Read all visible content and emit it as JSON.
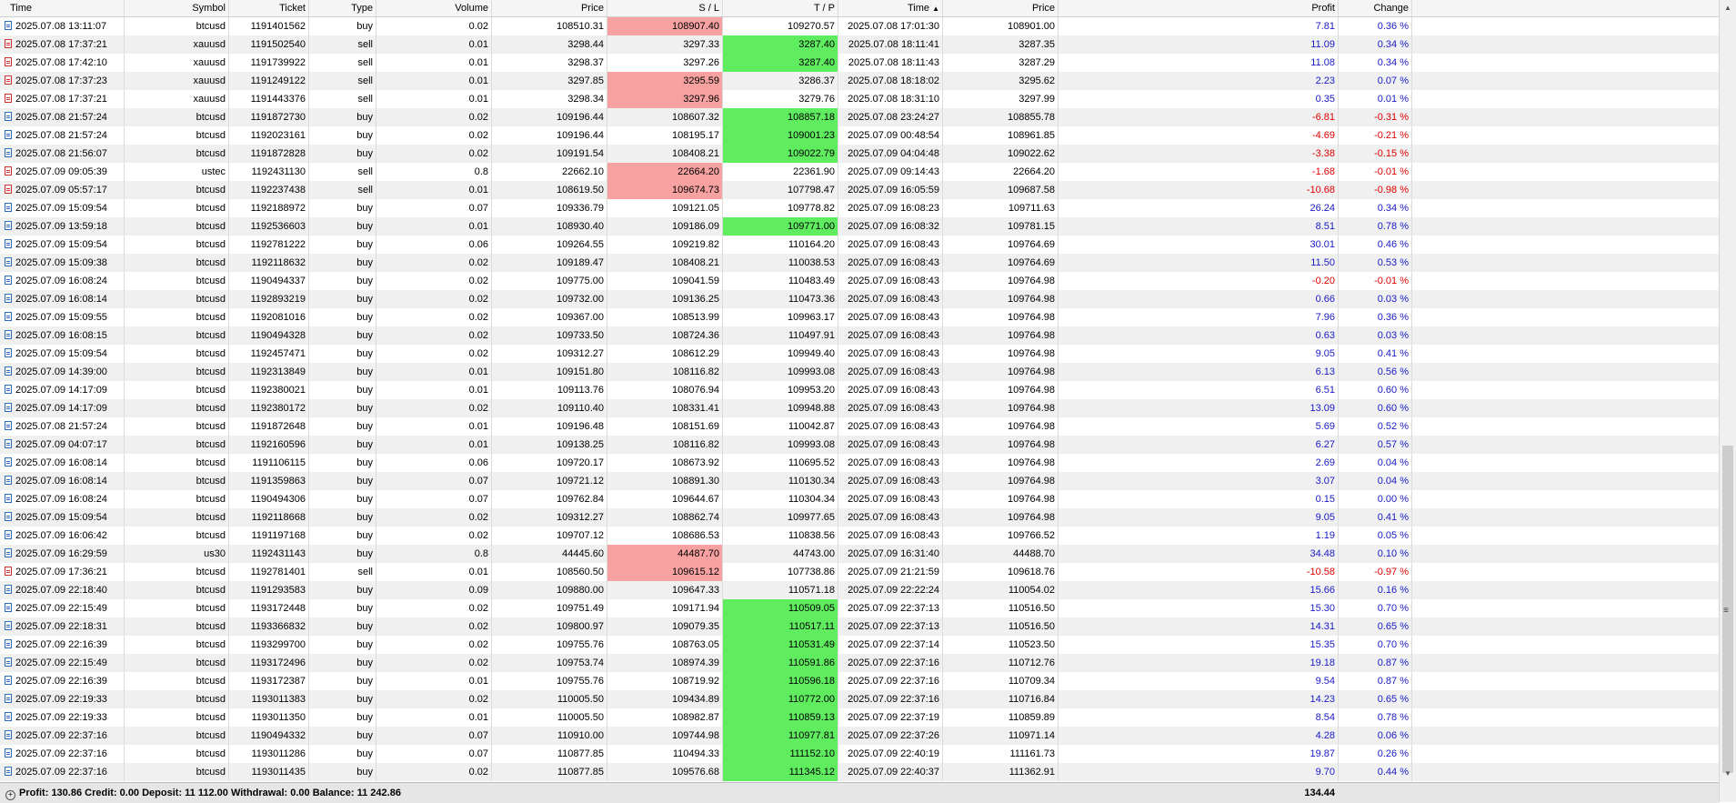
{
  "headers": {
    "time": "Time",
    "symbol": "Symbol",
    "ticket": "Ticket",
    "type": "Type",
    "volume": "Volume",
    "price": "Price",
    "sl": "S / L",
    "tp": "T / P",
    "close_time": "Time",
    "close_price": "Price",
    "profit": "Profit",
    "change": "Change",
    "sort_indicator": "▲"
  },
  "rows": [
    {
      "time": "2025.07.08 13:11:07",
      "symbol": "btcusd",
      "ticket": "1191401562",
      "type": "buy",
      "volume": "0.02",
      "price": "108510.31",
      "sl": "108907.40",
      "tp": "109270.57",
      "close_time": "2025.07.08 17:01:30",
      "close_price": "108901.00",
      "profit": "7.81",
      "change": "0.36 %",
      "hit": "sl"
    },
    {
      "time": "2025.07.08 17:37:21",
      "symbol": "xauusd",
      "ticket": "1191502540",
      "type": "sell",
      "volume": "0.01",
      "price": "3298.44",
      "sl": "3297.33",
      "tp": "3287.40",
      "close_time": "2025.07.08 18:11:41",
      "close_price": "3287.35",
      "profit": "11.09",
      "change": "0.34 %",
      "hit": "tp"
    },
    {
      "time": "2025.07.08 17:42:10",
      "symbol": "xauusd",
      "ticket": "1191739922",
      "type": "sell",
      "volume": "0.01",
      "price": "3298.37",
      "sl": "3297.26",
      "tp": "3287.40",
      "close_time": "2025.07.08 18:11:43",
      "close_price": "3287.29",
      "profit": "11.08",
      "change": "0.34 %",
      "hit": "tp"
    },
    {
      "time": "2025.07.08 17:37:23",
      "symbol": "xauusd",
      "ticket": "1191249122",
      "type": "sell",
      "volume": "0.01",
      "price": "3297.85",
      "sl": "3295.59",
      "tp": "3286.37",
      "close_time": "2025.07.08 18:18:02",
      "close_price": "3295.62",
      "profit": "2.23",
      "change": "0.07 %",
      "hit": "sl"
    },
    {
      "time": "2025.07.08 17:37:21",
      "symbol": "xauusd",
      "ticket": "1191443376",
      "type": "sell",
      "volume": "0.01",
      "price": "3298.34",
      "sl": "3297.96",
      "tp": "3279.76",
      "close_time": "2025.07.08 18:31:10",
      "close_price": "3297.99",
      "profit": "0.35",
      "change": "0.01 %",
      "hit": "sl"
    },
    {
      "time": "2025.07.08 21:57:24",
      "symbol": "btcusd",
      "ticket": "1191872730",
      "type": "buy",
      "volume": "0.02",
      "price": "109196.44",
      "sl": "108607.32",
      "tp": "108857.18",
      "close_time": "2025.07.08 23:24:27",
      "close_price": "108855.78",
      "profit": "-6.81",
      "change": "-0.31 %",
      "hit": "tp"
    },
    {
      "time": "2025.07.08 21:57:24",
      "symbol": "btcusd",
      "ticket": "1192023161",
      "type": "buy",
      "volume": "0.02",
      "price": "109196.44",
      "sl": "108195.17",
      "tp": "109001.23",
      "close_time": "2025.07.09 00:48:54",
      "close_price": "108961.85",
      "profit": "-4.69",
      "change": "-0.21 %",
      "hit": "tp"
    },
    {
      "time": "2025.07.08 21:56:07",
      "symbol": "btcusd",
      "ticket": "1191872828",
      "type": "buy",
      "volume": "0.02",
      "price": "109191.54",
      "sl": "108408.21",
      "tp": "109022.79",
      "close_time": "2025.07.09 04:04:48",
      "close_price": "109022.62",
      "profit": "-3.38",
      "change": "-0.15 %",
      "hit": "tp"
    },
    {
      "time": "2025.07.09 09:05:39",
      "symbol": "ustec",
      "ticket": "1192431130",
      "type": "sell",
      "volume": "0.8",
      "price": "22662.10",
      "sl": "22664.20",
      "tp": "22361.90",
      "close_time": "2025.07.09 09:14:43",
      "close_price": "22664.20",
      "profit": "-1.68",
      "change": "-0.01 %",
      "hit": "sl"
    },
    {
      "time": "2025.07.09 05:57:17",
      "symbol": "btcusd",
      "ticket": "1192237438",
      "type": "sell",
      "volume": "0.01",
      "price": "108619.50",
      "sl": "109674.73",
      "tp": "107798.47",
      "close_time": "2025.07.09 16:05:59",
      "close_price": "109687.58",
      "profit": "-10.68",
      "change": "-0.98 %",
      "hit": "sl"
    },
    {
      "time": "2025.07.09 15:09:54",
      "symbol": "btcusd",
      "ticket": "1192188972",
      "type": "buy",
      "volume": "0.07",
      "price": "109336.79",
      "sl": "109121.05",
      "tp": "109778.82",
      "close_time": "2025.07.09 16:08:23",
      "close_price": "109711.63",
      "profit": "26.24",
      "change": "0.34 %",
      "hit": ""
    },
    {
      "time": "2025.07.09 13:59:18",
      "symbol": "btcusd",
      "ticket": "1192536603",
      "type": "buy",
      "volume": "0.01",
      "price": "108930.40",
      "sl": "109186.09",
      "tp": "109771.00",
      "close_time": "2025.07.09 16:08:32",
      "close_price": "109781.15",
      "profit": "8.51",
      "change": "0.78 %",
      "hit": "tp"
    },
    {
      "time": "2025.07.09 15:09:54",
      "symbol": "btcusd",
      "ticket": "1192781222",
      "type": "buy",
      "volume": "0.06",
      "price": "109264.55",
      "sl": "109219.82",
      "tp": "110164.20",
      "close_time": "2025.07.09 16:08:43",
      "close_price": "109764.69",
      "profit": "30.01",
      "change": "0.46 %",
      "hit": ""
    },
    {
      "time": "2025.07.09 15:09:38",
      "symbol": "btcusd",
      "ticket": "1192118632",
      "type": "buy",
      "volume": "0.02",
      "price": "109189.47",
      "sl": "108408.21",
      "tp": "110038.53",
      "close_time": "2025.07.09 16:08:43",
      "close_price": "109764.69",
      "profit": "11.50",
      "change": "0.53 %",
      "hit": ""
    },
    {
      "time": "2025.07.09 16:08:24",
      "symbol": "btcusd",
      "ticket": "1190494337",
      "type": "buy",
      "volume": "0.02",
      "price": "109775.00",
      "sl": "109041.59",
      "tp": "110483.49",
      "close_time": "2025.07.09 16:08:43",
      "close_price": "109764.98",
      "profit": "-0.20",
      "change": "-0.01 %",
      "hit": ""
    },
    {
      "time": "2025.07.09 16:08:14",
      "symbol": "btcusd",
      "ticket": "1192893219",
      "type": "buy",
      "volume": "0.02",
      "price": "109732.00",
      "sl": "109136.25",
      "tp": "110473.36",
      "close_time": "2025.07.09 16:08:43",
      "close_price": "109764.98",
      "profit": "0.66",
      "change": "0.03 %",
      "hit": ""
    },
    {
      "time": "2025.07.09 15:09:55",
      "symbol": "btcusd",
      "ticket": "1192081016",
      "type": "buy",
      "volume": "0.02",
      "price": "109367.00",
      "sl": "108513.99",
      "tp": "109963.17",
      "close_time": "2025.07.09 16:08:43",
      "close_price": "109764.98",
      "profit": "7.96",
      "change": "0.36 %",
      "hit": ""
    },
    {
      "time": "2025.07.09 16:08:15",
      "symbol": "btcusd",
      "ticket": "1190494328",
      "type": "buy",
      "volume": "0.02",
      "price": "109733.50",
      "sl": "108724.36",
      "tp": "110497.91",
      "close_time": "2025.07.09 16:08:43",
      "close_price": "109764.98",
      "profit": "0.63",
      "change": "0.03 %",
      "hit": ""
    },
    {
      "time": "2025.07.09 15:09:54",
      "symbol": "btcusd",
      "ticket": "1192457471",
      "type": "buy",
      "volume": "0.02",
      "price": "109312.27",
      "sl": "108612.29",
      "tp": "109949.40",
      "close_time": "2025.07.09 16:08:43",
      "close_price": "109764.98",
      "profit": "9.05",
      "change": "0.41 %",
      "hit": ""
    },
    {
      "time": "2025.07.09 14:39:00",
      "symbol": "btcusd",
      "ticket": "1192313849",
      "type": "buy",
      "volume": "0.01",
      "price": "109151.80",
      "sl": "108116.82",
      "tp": "109993.08",
      "close_time": "2025.07.09 16:08:43",
      "close_price": "109764.98",
      "profit": "6.13",
      "change": "0.56 %",
      "hit": ""
    },
    {
      "time": "2025.07.09 14:17:09",
      "symbol": "btcusd",
      "ticket": "1192380021",
      "type": "buy",
      "volume": "0.01",
      "price": "109113.76",
      "sl": "108076.94",
      "tp": "109953.20",
      "close_time": "2025.07.09 16:08:43",
      "close_price": "109764.98",
      "profit": "6.51",
      "change": "0.60 %",
      "hit": ""
    },
    {
      "time": "2025.07.09 14:17:09",
      "symbol": "btcusd",
      "ticket": "1192380172",
      "type": "buy",
      "volume": "0.02",
      "price": "109110.40",
      "sl": "108331.41",
      "tp": "109948.88",
      "close_time": "2025.07.09 16:08:43",
      "close_price": "109764.98",
      "profit": "13.09",
      "change": "0.60 %",
      "hit": ""
    },
    {
      "time": "2025.07.08 21:57:24",
      "symbol": "btcusd",
      "ticket": "1191872648",
      "type": "buy",
      "volume": "0.01",
      "price": "109196.48",
      "sl": "108151.69",
      "tp": "110042.87",
      "close_time": "2025.07.09 16:08:43",
      "close_price": "109764.98",
      "profit": "5.69",
      "change": "0.52 %",
      "hit": ""
    },
    {
      "time": "2025.07.09 04:07:17",
      "symbol": "btcusd",
      "ticket": "1192160596",
      "type": "buy",
      "volume": "0.01",
      "price": "109138.25",
      "sl": "108116.82",
      "tp": "109993.08",
      "close_time": "2025.07.09 16:08:43",
      "close_price": "109764.98",
      "profit": "6.27",
      "change": "0.57 %",
      "hit": ""
    },
    {
      "time": "2025.07.09 16:08:14",
      "symbol": "btcusd",
      "ticket": "1191106115",
      "type": "buy",
      "volume": "0.06",
      "price": "109720.17",
      "sl": "108673.92",
      "tp": "110695.52",
      "close_time": "2025.07.09 16:08:43",
      "close_price": "109764.98",
      "profit": "2.69",
      "change": "0.04 %",
      "hit": ""
    },
    {
      "time": "2025.07.09 16:08:14",
      "symbol": "btcusd",
      "ticket": "1191359863",
      "type": "buy",
      "volume": "0.07",
      "price": "109721.12",
      "sl": "108891.30",
      "tp": "110130.34",
      "close_time": "2025.07.09 16:08:43",
      "close_price": "109764.98",
      "profit": "3.07",
      "change": "0.04 %",
      "hit": ""
    },
    {
      "time": "2025.07.09 16:08:24",
      "symbol": "btcusd",
      "ticket": "1190494306",
      "type": "buy",
      "volume": "0.07",
      "price": "109762.84",
      "sl": "109644.67",
      "tp": "110304.34",
      "close_time": "2025.07.09 16:08:43",
      "close_price": "109764.98",
      "profit": "0.15",
      "change": "0.00 %",
      "hit": ""
    },
    {
      "time": "2025.07.09 15:09:54",
      "symbol": "btcusd",
      "ticket": "1192118668",
      "type": "buy",
      "volume": "0.02",
      "price": "109312.27",
      "sl": "108862.74",
      "tp": "109977.65",
      "close_time": "2025.07.09 16:08:43",
      "close_price": "109764.98",
      "profit": "9.05",
      "change": "0.41 %",
      "hit": ""
    },
    {
      "time": "2025.07.09 16:06:42",
      "symbol": "btcusd",
      "ticket": "1191197168",
      "type": "buy",
      "volume": "0.02",
      "price": "109707.12",
      "sl": "108686.53",
      "tp": "110838.56",
      "close_time": "2025.07.09 16:08:43",
      "close_price": "109766.52",
      "profit": "1.19",
      "change": "0.05 %",
      "hit": ""
    },
    {
      "time": "2025.07.09 16:29:59",
      "symbol": "us30",
      "ticket": "1192431143",
      "type": "buy",
      "volume": "0.8",
      "price": "44445.60",
      "sl": "44487.70",
      "tp": "44743.00",
      "close_time": "2025.07.09 16:31:40",
      "close_price": "44488.70",
      "profit": "34.48",
      "change": "0.10 %",
      "hit": "sl"
    },
    {
      "time": "2025.07.09 17:36:21",
      "symbol": "btcusd",
      "ticket": "1192781401",
      "type": "sell",
      "volume": "0.01",
      "price": "108560.50",
      "sl": "109615.12",
      "tp": "107738.86",
      "close_time": "2025.07.09 21:21:59",
      "close_price": "109618.76",
      "profit": "-10.58",
      "change": "-0.97 %",
      "hit": "sl"
    },
    {
      "time": "2025.07.09 22:18:40",
      "symbol": "btcusd",
      "ticket": "1191293583",
      "type": "buy",
      "volume": "0.09",
      "price": "109880.00",
      "sl": "109647.33",
      "tp": "110571.18",
      "close_time": "2025.07.09 22:22:24",
      "close_price": "110054.02",
      "profit": "15.66",
      "change": "0.16 %",
      "hit": ""
    },
    {
      "time": "2025.07.09 22:15:49",
      "symbol": "btcusd",
      "ticket": "1193172448",
      "type": "buy",
      "volume": "0.02",
      "price": "109751.49",
      "sl": "109171.94",
      "tp": "110509.05",
      "close_time": "2025.07.09 22:37:13",
      "close_price": "110516.50",
      "profit": "15.30",
      "change": "0.70 %",
      "hit": "tp"
    },
    {
      "time": "2025.07.09 22:18:31",
      "symbol": "btcusd",
      "ticket": "1193366832",
      "type": "buy",
      "volume": "0.02",
      "price": "109800.97",
      "sl": "109079.35",
      "tp": "110517.11",
      "close_time": "2025.07.09 22:37:13",
      "close_price": "110516.50",
      "profit": "14.31",
      "change": "0.65 %",
      "hit": "tp"
    },
    {
      "time": "2025.07.09 22:16:39",
      "symbol": "btcusd",
      "ticket": "1193299700",
      "type": "buy",
      "volume": "0.02",
      "price": "109755.76",
      "sl": "108763.05",
      "tp": "110531.49",
      "close_time": "2025.07.09 22:37:14",
      "close_price": "110523.50",
      "profit": "15.35",
      "change": "0.70 %",
      "hit": "tp"
    },
    {
      "time": "2025.07.09 22:15:49",
      "symbol": "btcusd",
      "ticket": "1193172496",
      "type": "buy",
      "volume": "0.02",
      "price": "109753.74",
      "sl": "108974.39",
      "tp": "110591.86",
      "close_time": "2025.07.09 22:37:16",
      "close_price": "110712.76",
      "profit": "19.18",
      "change": "0.87 %",
      "hit": "tp"
    },
    {
      "time": "2025.07.09 22:16:39",
      "symbol": "btcusd",
      "ticket": "1193172387",
      "type": "buy",
      "volume": "0.01",
      "price": "109755.76",
      "sl": "108719.92",
      "tp": "110596.18",
      "close_time": "2025.07.09 22:37:16",
      "close_price": "110709.34",
      "profit": "9.54",
      "change": "0.87 %",
      "hit": "tp"
    },
    {
      "time": "2025.07.09 22:19:33",
      "symbol": "btcusd",
      "ticket": "1193011383",
      "type": "buy",
      "volume": "0.02",
      "price": "110005.50",
      "sl": "109434.89",
      "tp": "110772.00",
      "close_time": "2025.07.09 22:37:16",
      "close_price": "110716.84",
      "profit": "14.23",
      "change": "0.65 %",
      "hit": "tp"
    },
    {
      "time": "2025.07.09 22:19:33",
      "symbol": "btcusd",
      "ticket": "1193011350",
      "type": "buy",
      "volume": "0.01",
      "price": "110005.50",
      "sl": "108982.87",
      "tp": "110859.13",
      "close_time": "2025.07.09 22:37:19",
      "close_price": "110859.89",
      "profit": "8.54",
      "change": "0.78 %",
      "hit": "tp"
    },
    {
      "time": "2025.07.09 22:37:16",
      "symbol": "btcusd",
      "ticket": "1190494332",
      "type": "buy",
      "volume": "0.07",
      "price": "110910.00",
      "sl": "109744.98",
      "tp": "110977.81",
      "close_time": "2025.07.09 22:37:26",
      "close_price": "110971.14",
      "profit": "4.28",
      "change": "0.06 %",
      "hit": "tp"
    },
    {
      "time": "2025.07.09 22:37:16",
      "symbol": "btcusd",
      "ticket": "1193011286",
      "type": "buy",
      "volume": "0.07",
      "price": "110877.85",
      "sl": "110494.33",
      "tp": "111152.10",
      "close_time": "2025.07.09 22:40:19",
      "close_price": "111161.73",
      "profit": "19.87",
      "change": "0.26 %",
      "hit": "tp"
    },
    {
      "time": "2025.07.09 22:37:16",
      "symbol": "btcusd",
      "ticket": "1193011435",
      "type": "buy",
      "volume": "0.02",
      "price": "110877.85",
      "sl": "109576.68",
      "tp": "111345.12",
      "close_time": "2025.07.09 22:40:37",
      "close_price": "111362.91",
      "profit": "9.70",
      "change": "0.44 %",
      "hit": "tp"
    }
  ],
  "footer": {
    "summary": "Profit: 130.86  Credit: 0.00  Deposit: 11 112.00  Withdrawal: 0.00  Balance: 11 242.86",
    "total_profit": "134.44"
  },
  "colors": {
    "sl_hit": "#f7a1a1",
    "tp_hit": "#5fec5f",
    "negative": "#e00000",
    "positive": "#1a1ac8"
  }
}
